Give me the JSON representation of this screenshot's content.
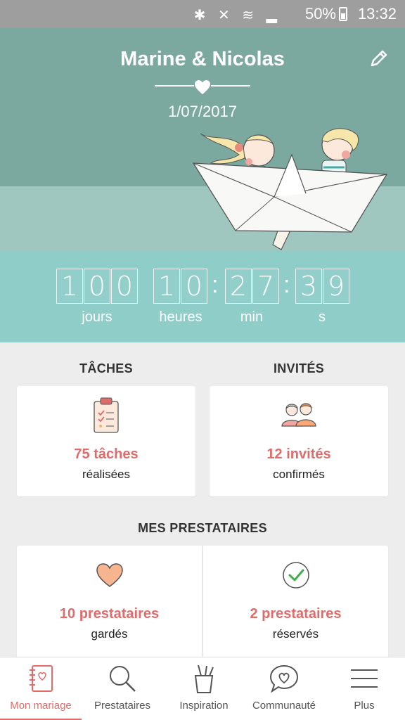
{
  "status_bar": {
    "battery": "50%",
    "time": "13:32",
    "icons": [
      "bluetooth-icon",
      "mute-icon",
      "wifi-icon",
      "signal-icon"
    ]
  },
  "header": {
    "couple": "Marine & Nicolas",
    "date": "1/07/2017"
  },
  "countdown": {
    "days": [
      "1",
      "0",
      "0"
    ],
    "hours": [
      "1",
      "0"
    ],
    "minutes": [
      "2",
      "7"
    ],
    "seconds": [
      "3",
      "9"
    ],
    "labels": {
      "days": "jours",
      "hours": "heures",
      "minutes": "min",
      "seconds": "s"
    }
  },
  "tasks": {
    "title": "TÂCHES",
    "count": "75 tâches",
    "status": "réalisées"
  },
  "guests": {
    "title": "INVITÉS",
    "count": "12 invités",
    "status": "confirmés"
  },
  "vendors": {
    "title": "MES PRESTATAIRES",
    "kept_count": "10 prestataires",
    "kept_status": "gardés",
    "booked_count": "2 prestataires",
    "booked_status": "réservés"
  },
  "nav": {
    "items": [
      {
        "label": "Mon mariage",
        "icon": "notebook-icon"
      },
      {
        "label": "Prestataires",
        "icon": "search-icon"
      },
      {
        "label": "Inspiration",
        "icon": "pencil-cup-icon"
      },
      {
        "label": "Communauté",
        "icon": "chat-heart-icon"
      },
      {
        "label": "Plus",
        "icon": "menu-icon"
      }
    ]
  },
  "colors": {
    "accent": "#e06b6b",
    "header_bg": "#7ba9a0",
    "countdown_bg": "#8ecdc8",
    "status_bar": "#9e9e9e"
  }
}
